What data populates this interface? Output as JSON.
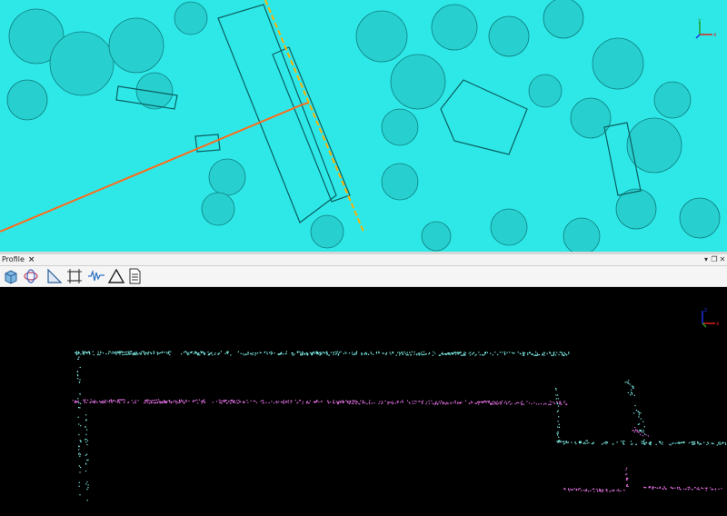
{
  "panel": {
    "tab_label": "Profile",
    "close_symbol": "×",
    "dropdown_symbol": "▾",
    "restore_symbol": "❐",
    "close_panel_symbol": "✕"
  },
  "toolbar": {
    "tools": [
      {
        "icon": "cube-view-icon"
      },
      {
        "icon": "orbit-icon"
      },
      {
        "icon": "slope-icon"
      },
      {
        "icon": "crop-frame-icon"
      },
      {
        "icon": "waveform-icon"
      },
      {
        "icon": "triangle-measure-icon"
      },
      {
        "icon": "document-icon"
      }
    ]
  },
  "map_axes": {
    "x_label": "x",
    "y_label": "y",
    "z_label": "z"
  },
  "profile_axes": {
    "x_label": "x",
    "y_label": "y",
    "z_label": "z"
  },
  "colors": {
    "map_background": "#2ee8e8",
    "profile_line": "#ff6a1a",
    "section_line": "#ffb000",
    "cyan_points": "#7ff0e8",
    "magenta_points": "#e070e0",
    "profile_background": "#000000"
  }
}
